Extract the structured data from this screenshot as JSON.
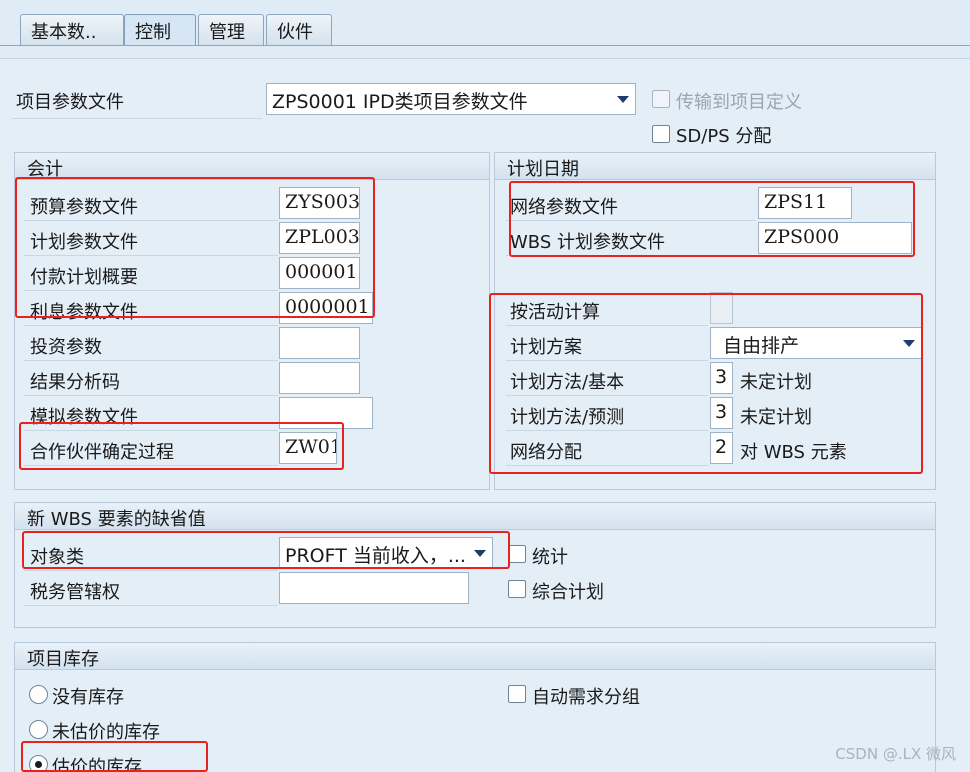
{
  "tabs": [
    "基本数..",
    "控制",
    "管理",
    "伙件"
  ],
  "top": {
    "project_profile_label": "项目参数文件",
    "project_profile_value": "ZPS0001 IPD类项目参数文件",
    "transfer_label": "传输到项目定义",
    "sdps_label": "SD/PS 分配"
  },
  "accounting": {
    "title": "会计",
    "rows": [
      {
        "label": "预算参数文件",
        "value": "ZYS003"
      },
      {
        "label": "计划参数文件",
        "value": "ZPL003"
      },
      {
        "label": "付款计划概要",
        "value": "000001"
      },
      {
        "label": "利息参数文件",
        "value": "0000001"
      },
      {
        "label": "投资参数",
        "value": ""
      },
      {
        "label": "结果分析码",
        "value": ""
      },
      {
        "label": "模拟参数文件",
        "value": ""
      },
      {
        "label": "合作伙伴确定过程",
        "value": "ZW01"
      }
    ]
  },
  "planning": {
    "title": "计划日期",
    "network_profile_label": "网络参数文件",
    "network_profile_value": "ZPS11",
    "wbs_profile_label": "WBS 计划参数文件",
    "wbs_profile_value": "ZPS000",
    "calc_by_activity_label": "按活动计算",
    "plan_scheme_label": "计划方案",
    "plan_scheme_value": "自由排产",
    "method_basic_label": "计划方法/基本",
    "method_basic_value": "3",
    "method_basic_text": "未定计划",
    "method_forecast_label": "计划方法/预测",
    "method_forecast_value": "3",
    "method_forecast_text": "未定计划",
    "network_assign_label": "网络分配",
    "network_assign_value": "2",
    "network_assign_text": "对 WBS 元素"
  },
  "new_wbs": {
    "title": "新 WBS 要素的缺省值",
    "object_class_label": "对象类",
    "object_class_value": "PROFT 当前收入，...",
    "statistical_label": "统计",
    "tax_label": "税务管辖权",
    "tax_value": "",
    "integrated_label": "综合计划"
  },
  "stock": {
    "title": "项目库存",
    "no_stock_label": "没有库存",
    "non_valuated_label": "未估价的库存",
    "valuated_label": "估价的库存",
    "auto_req_label": "自动需求分组"
  },
  "watermark": "CSDN @.LX 微风"
}
